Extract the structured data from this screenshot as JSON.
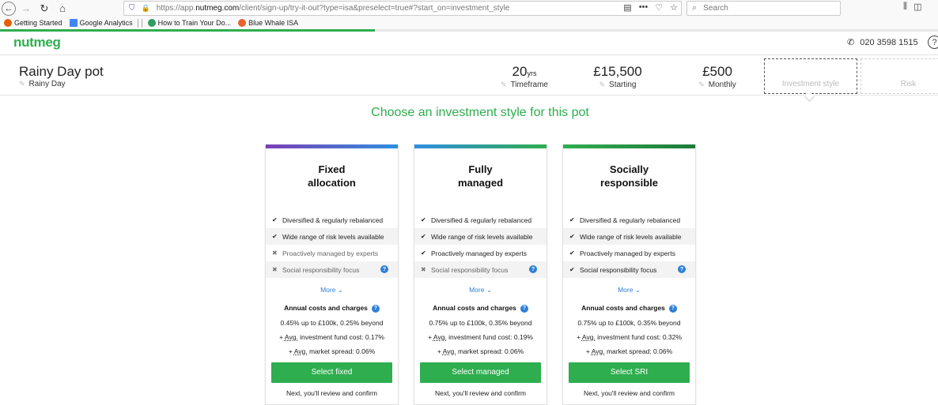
{
  "browser": {
    "url_prefix": "https://app.",
    "url_domain": "nutmeg.com",
    "url_path": "/client/sign-up/try-it-out?type=isa&preselect=true#?start_on=investment_style",
    "search_placeholder": "Search",
    "bookmarks": [
      {
        "label": "Getting Started",
        "icon_color": "#e66000"
      },
      {
        "label": "Google Analytics",
        "icon_color": "#4285f4"
      },
      {
        "label": "How to Train Your Do...",
        "icon_color": "#2e9e5e"
      },
      {
        "label": "Blue Whale ISA",
        "icon_color": "#e8642c"
      }
    ],
    "load_progress": 0.4
  },
  "header": {
    "logo": "nutmeg",
    "phone": "020 3598 1515",
    "help": "?"
  },
  "summary": {
    "pot_name": "Rainy Day pot",
    "pot_sub": "Rainy Day",
    "timeframe_value": "20",
    "timeframe_unit": "yrs",
    "timeframe_label": "Timeframe",
    "starting_value": "£15,500",
    "starting_label": "Starting",
    "monthly_value": "£500",
    "monthly_label": "Monthly",
    "step_active": "Investment style",
    "step_next": "Risk"
  },
  "main": {
    "title": "Choose an investment style for this pot",
    "more_label": "More",
    "costs_title": "Annual costs and charges",
    "next_note": "Next, you'll review and confirm",
    "cards": [
      {
        "title_line1": "Fixed",
        "title_line2": "allocation",
        "bar_from": "#7b3fb5",
        "bar_to": "#2f8fe0",
        "features": [
          {
            "label": "Diversified & regularly rebalanced",
            "included": true
          },
          {
            "label": "Wide range of risk levels available",
            "included": true
          },
          {
            "label": "Proactively managed by experts",
            "included": false
          },
          {
            "label": "Social responsibility focus",
            "included": false
          }
        ],
        "cost_base": "0.45% up to £100k, 0.25% beyond",
        "cost_fund": "investment fund cost: 0.17%",
        "cost_spread": "market spread: 0.06%",
        "button": "Select fixed"
      },
      {
        "title_line1": "Fully",
        "title_line2": "managed",
        "bar_from": "#2f8fe0",
        "bar_to": "#2eae4f",
        "features": [
          {
            "label": "Diversified & regularly rebalanced",
            "included": true
          },
          {
            "label": "Wide range of risk levels available",
            "included": true
          },
          {
            "label": "Proactively managed by experts",
            "included": true
          },
          {
            "label": "Social responsibility focus",
            "included": false
          }
        ],
        "cost_base": "0.75% up to £100k, 0.35% beyond",
        "cost_fund": "investment fund cost: 0.19%",
        "cost_spread": "market spread: 0.06%",
        "button": "Select managed"
      },
      {
        "title_line1": "Socially",
        "title_line2": "responsible",
        "bar_from": "#2eae4f",
        "bar_to": "#1f7a3a",
        "features": [
          {
            "label": "Diversified & regularly rebalanced",
            "included": true
          },
          {
            "label": "Wide range of risk levels available",
            "included": true
          },
          {
            "label": "Proactively managed by experts",
            "included": true
          },
          {
            "label": "Social responsibility focus",
            "included": true
          }
        ],
        "cost_base": "0.75% up to £100k, 0.35% beyond",
        "cost_fund": "investment fund cost: 0.32%",
        "cost_spread": "market spread: 0.06%",
        "button": "Select SRI"
      }
    ],
    "avg_label": "Avg."
  }
}
